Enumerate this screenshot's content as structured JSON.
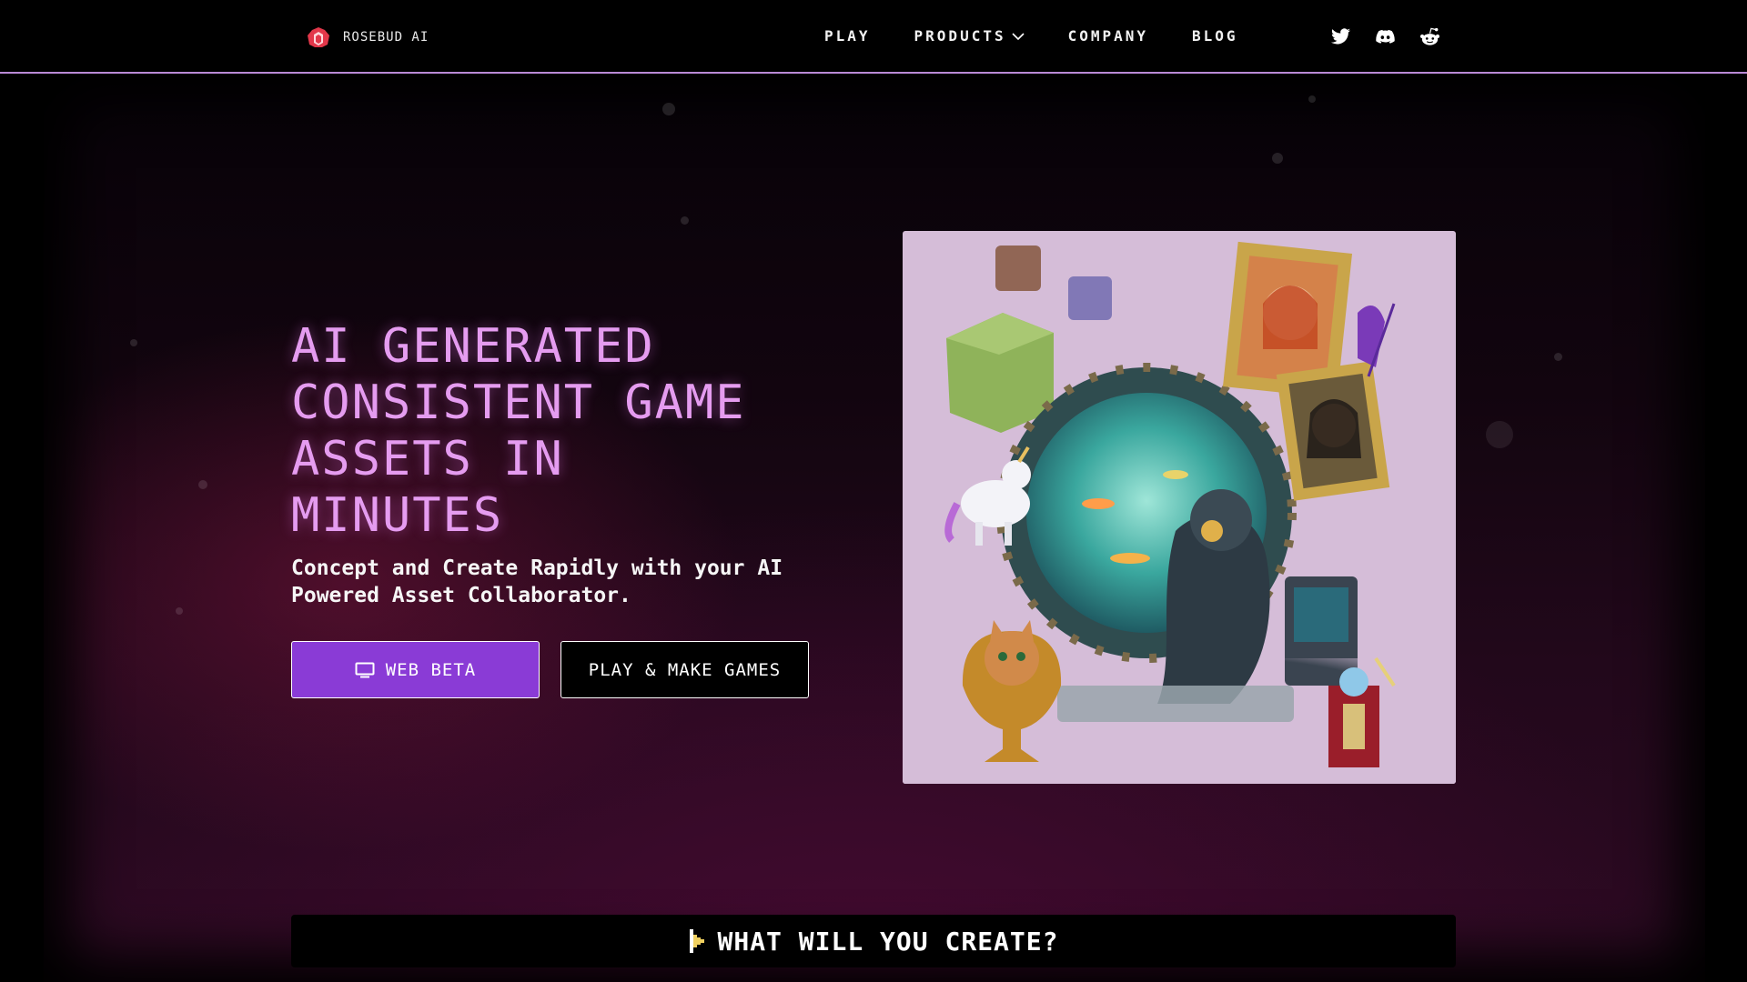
{
  "brand": {
    "name": "ROSEBUD AI",
    "accent": "#e63946"
  },
  "nav": {
    "links": [
      {
        "label": "PLAY"
      },
      {
        "label": "PRODUCTS",
        "has_dropdown": true
      },
      {
        "label": "COMPANY"
      },
      {
        "label": "BLOG"
      }
    ],
    "social_icons": [
      "twitter-icon",
      "discord-icon",
      "reddit-icon"
    ]
  },
  "hero": {
    "headline": "AI GENERATED CONSISTENT GAME ASSETS IN MINUTES",
    "subheadline": "Concept and Create Rapidly with your AI Powered Asset Collaborator.",
    "primary_button": {
      "label": "WEB BETA",
      "icon": "monitor-icon",
      "color": "#8a3bd6"
    },
    "secondary_button": {
      "label": "PLAY & MAKE GAMES"
    },
    "headline_color": "#e59cf0"
  },
  "banner": {
    "icon": "pixel-cursor-icon",
    "label": "WHAT WILL YOU CREATE?"
  }
}
